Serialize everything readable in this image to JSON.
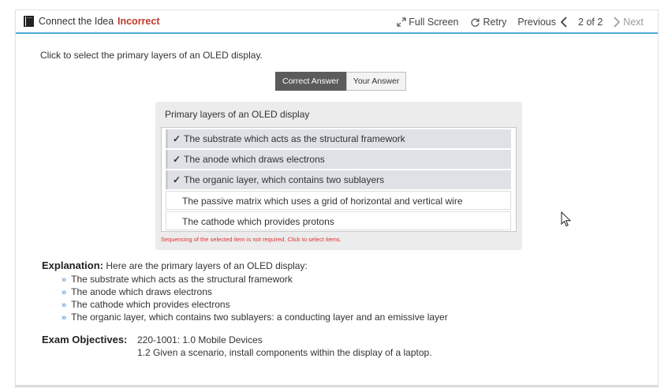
{
  "header": {
    "title": "Connect the Idea",
    "status": "Incorrect",
    "full_screen_label": "Full Screen",
    "retry_label": "Retry",
    "previous_label": "Previous",
    "page_indicator": "2 of 2",
    "next_label": "Next",
    "status_color": "#c0392b",
    "accent_color": "#4ea6d8"
  },
  "question": {
    "prompt": "Click to select the primary layers of an OLED display."
  },
  "answer_toggle": {
    "correct_label": "Correct Answer",
    "your_label": "Your Answer",
    "active": "correct"
  },
  "panel": {
    "title": "Primary layers of an OLED display",
    "items": [
      {
        "label": "The substrate which acts as the structural framework",
        "selected": true
      },
      {
        "label": "The anode which draws electrons",
        "selected": true
      },
      {
        "label": "The organic layer, which contains two sublayers",
        "selected": true
      },
      {
        "label": "The passive matrix which uses a grid of horizontal and vertical wire",
        "selected": false
      },
      {
        "label": "The cathode which provides protons",
        "selected": false
      }
    ],
    "check_glyph": "✓",
    "hint": "Sequencing of the selected item is not required. Click to select items."
  },
  "explanation": {
    "label": "Explanation:",
    "intro": "Here are the primary layers of an OLED display:",
    "bullet_glyph": "»",
    "bullets": [
      "The substrate which acts as the structural framework",
      "The anode which draws electrons",
      "The cathode which provides electrons",
      "The organic layer, which contains two sublayers: a conducting layer and an emissive layer"
    ]
  },
  "objectives": {
    "label": "Exam Objectives:",
    "line1": "220-1001: 1.0 Mobile Devices",
    "line2": "1.2 Given a scenario, install components within the display of a laptop."
  }
}
